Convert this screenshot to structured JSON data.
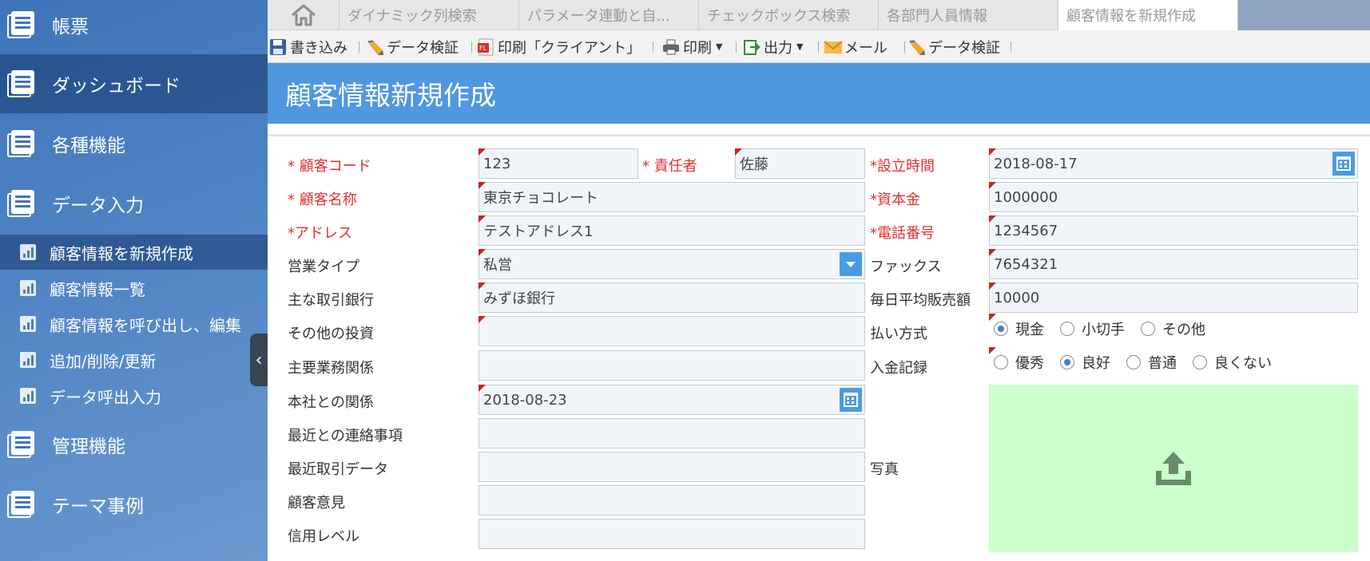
{
  "sidebar": {
    "groups": [
      {
        "label": "帳票"
      },
      {
        "label": "ダッシュボード"
      },
      {
        "label": "各種機能"
      },
      {
        "label": "データ入力"
      },
      {
        "label": "管理機能"
      },
      {
        "label": "テーマ事例"
      }
    ],
    "subitems": [
      {
        "label": "顧客情報を新規作成"
      },
      {
        "label": "顧客情報一覧"
      },
      {
        "label": "顧客情報を呼び出し、編集"
      },
      {
        "label": "追加/削除/更新"
      },
      {
        "label": "データ呼出入力"
      }
    ],
    "collapse_glyph": "‹"
  },
  "tabs": [
    {
      "label": "ダイナミック列検索"
    },
    {
      "label": "パラメータ連動と自..."
    },
    {
      "label": "チェックボックス検索"
    },
    {
      "label": "各部門人員情報"
    },
    {
      "label": "顧客情報を新規作成"
    }
  ],
  "toolbar": {
    "write": "書き込み",
    "validate1": "データ検証",
    "print_client": "印刷「クライアント」",
    "print": "印刷",
    "export": "出力",
    "mail": "メール",
    "validate2": "データ検証"
  },
  "page_title": "顧客情報新規作成",
  "form": {
    "customer_code": {
      "label": "* 顧客コード",
      "value": "123"
    },
    "manager": {
      "label": "* 責任者",
      "value": "佐藤"
    },
    "established": {
      "label": "*設立時間",
      "value": "2018-08-17"
    },
    "customer_name": {
      "label": "* 顧客名称",
      "value": "東京チョコレート"
    },
    "capital": {
      "label": "*資本金",
      "value": "1000000"
    },
    "address": {
      "label": "*アドレス",
      "value": "テストアドレス1"
    },
    "phone": {
      "label": "*電話番号",
      "value": "1234567"
    },
    "business_type": {
      "label": "営業タイプ",
      "value": "私営"
    },
    "fax": {
      "label": "ファックス",
      "value": "7654321"
    },
    "main_bank": {
      "label": "主な取引銀行",
      "value": "みずほ銀行"
    },
    "daily_sales": {
      "label": "毎日平均販売額",
      "value": "10000"
    },
    "other_investment": {
      "label": "その他の投資",
      "value": ""
    },
    "payment_method": {
      "label": "払い方式",
      "options": [
        "現金",
        "小切手",
        "その他"
      ],
      "selected": "現金"
    },
    "main_business": {
      "label": "主要業務関係",
      "value": ""
    },
    "payment_record": {
      "label": "入金記録",
      "options": [
        "優秀",
        "良好",
        "普通",
        "良くない"
      ],
      "selected": "良好"
    },
    "hq_relation": {
      "label": "本社との関係",
      "value": "2018-08-23"
    },
    "recent_contact": {
      "label": "最近との連絡事項",
      "value": ""
    },
    "recent_trade": {
      "label": "最近取引データ",
      "value": ""
    },
    "photo": {
      "label": "写真"
    },
    "customer_opinion": {
      "label": "顧客意見",
      "value": ""
    },
    "credit_level": {
      "label": "信用レベル",
      "value": ""
    }
  },
  "colors": {
    "title_bar": "#5097df",
    "required_label": "#e03030",
    "upload_area": "#ccffcc",
    "upload_icon": "#6b8a6b",
    "radio_selected": "#3b7fd8"
  },
  "icons": {
    "home": "home-icon",
    "save": "save-icon",
    "validate": "pencil-ruler-icon",
    "pdf": "pdf-icon",
    "printer": "printer-icon",
    "export": "export-icon",
    "mail": "mail-icon",
    "calendar": "calendar-icon",
    "dropdown": "chevron-down-icon",
    "upload": "upload-icon"
  }
}
